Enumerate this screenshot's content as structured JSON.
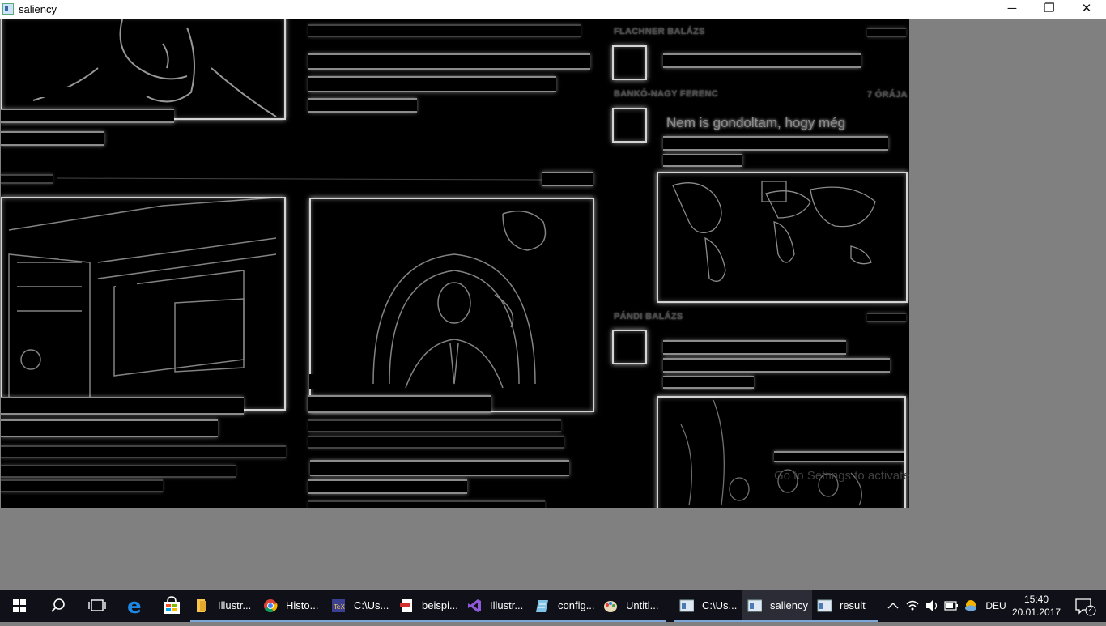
{
  "window": {
    "title": "saliency",
    "minimize_label": "─",
    "maximize_label": "❐",
    "close_label": "✕"
  },
  "canvas": {
    "byline_1": "FLACHNER BALÁZS",
    "byline_2": "BANKÓ-NAGY FERENC",
    "time_2": "7 ÓRÁJA",
    "headline": "Nem is gondoltam, hogy még",
    "byline_3": "PÁNDI BALÁZS",
    "watermark": "Go to Settings to activate"
  },
  "taskbar": {
    "items": [
      {
        "label": "Illustr...",
        "icon": "folder-icon"
      },
      {
        "label": "Histo...",
        "icon": "chrome-icon"
      },
      {
        "label": "C:\\Us...",
        "icon": "texmaker-icon"
      },
      {
        "label": "beispi...",
        "icon": "pdf-icon"
      },
      {
        "label": "Illustr...",
        "icon": "visual-studio-icon"
      },
      {
        "label": "config...",
        "icon": "notepad-icon"
      },
      {
        "label": "Untitl...",
        "icon": "paint-icon"
      },
      {
        "label": "C:\\Us...",
        "icon": "window-app-icon"
      },
      {
        "label": "saliency",
        "icon": "window-app-icon"
      },
      {
        "label": "result",
        "icon": "window-app-icon"
      }
    ],
    "language": "DEU",
    "time": "15:40",
    "date": "20.01.2017",
    "notification_count": "2"
  }
}
